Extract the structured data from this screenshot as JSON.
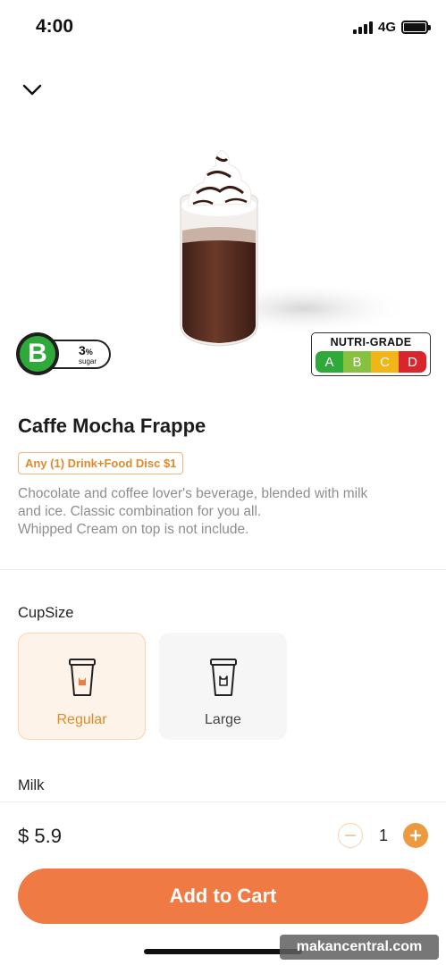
{
  "status_bar": {
    "time": "4:00",
    "network": "4G",
    "icons": [
      "signal-icon",
      "battery-icon"
    ]
  },
  "header": {
    "collapse_icon": "chevron-down-icon"
  },
  "nutri_badge": {
    "grade": "B",
    "sugar_value": "3",
    "sugar_unit": "%",
    "sugar_label": "sugar"
  },
  "nutri_legend": {
    "title": "NUTRI-GRADE",
    "grades": [
      {
        "label": "A",
        "color": "#2fa93a"
      },
      {
        "label": "B",
        "color": "#86c13f"
      },
      {
        "label": "C",
        "color": "#f2b417"
      },
      {
        "label": "D",
        "color": "#d9262c"
      }
    ]
  },
  "product": {
    "title": "Caffe Mocha Frappe",
    "promo": "Any (1) Drink+Food Disc $1",
    "description_lines": [
      "Chocolate and coffee lover's beverage, blended with milk",
      "and ice. Classic combination for you all.",
      "Whipped Cream on top is not include."
    ]
  },
  "options": {
    "cup_size_label": "CupSize",
    "cup_sizes": [
      {
        "label": "Regular",
        "selected": true
      },
      {
        "label": "Large",
        "selected": false
      }
    ],
    "milk_label": "Milk"
  },
  "footer": {
    "price": "$ 5.9",
    "quantity": "1",
    "add_to_cart": "Add to Cart"
  },
  "watermark": "makancentral.com",
  "colors": {
    "accent": "#ef7a43",
    "accent_light": "#fdf3e8",
    "promo": "#e08a2c",
    "plus_button": "#eb9a3f"
  }
}
